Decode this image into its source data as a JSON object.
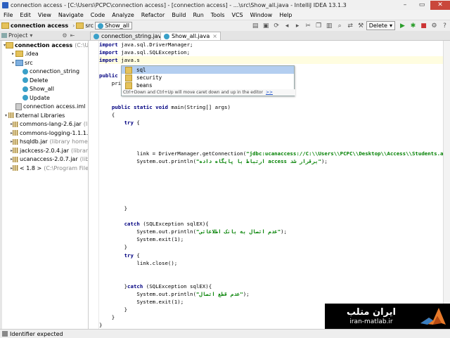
{
  "window": {
    "title": "connection access - [C:\\Users\\PCPC\\connection access] - [connection access] - ...\\src\\Show_all.java - IntelliJ IDEA 13.1.3"
  },
  "menu": [
    "File",
    "Edit",
    "View",
    "Navigate",
    "Code",
    "Analyze",
    "Refactor",
    "Build",
    "Run",
    "Tools",
    "VCS",
    "Window",
    "Help"
  ],
  "breadcrumbs": [
    "connection access",
    "src",
    "Show_all"
  ],
  "toolbar": {
    "run_config": "Delete"
  },
  "project_tab": "Project",
  "editor_tabs": [
    {
      "label": "connection_string.java",
      "active": false
    },
    {
      "label": "Show_all.java",
      "active": true
    }
  ],
  "project_tree": [
    {
      "label": "connection access",
      "note": "(C:\\Users\\PCPC",
      "indent": 0,
      "arrow": "▾",
      "icon": "folder",
      "bold": true
    },
    {
      "label": ".idea",
      "note": "",
      "indent": 1,
      "arrow": "▸",
      "icon": "folder"
    },
    {
      "label": "src",
      "note": "",
      "indent": 1,
      "arrow": "▾",
      "icon": "src"
    },
    {
      "label": "connection_string",
      "note": "",
      "indent": 2,
      "arrow": "",
      "icon": "class"
    },
    {
      "label": "Delete",
      "note": "",
      "indent": 2,
      "arrow": "",
      "icon": "class"
    },
    {
      "label": "Show_all",
      "note": "",
      "indent": 2,
      "arrow": "",
      "icon": "class"
    },
    {
      "label": "Update",
      "note": "",
      "indent": 2,
      "arrow": "",
      "icon": "class"
    },
    {
      "label": "connection access.iml",
      "note": "",
      "indent": 1,
      "arrow": "",
      "icon": "iml"
    },
    {
      "label": "External Libraries",
      "note": "",
      "indent": 0,
      "arrow": "▾",
      "icon": "lib"
    },
    {
      "label": "commons-lang-2.6.jar",
      "note": "(library",
      "indent": 1,
      "arrow": "▸",
      "icon": "lib"
    },
    {
      "label": "commons-logging-1.1.1.jar",
      "note": "(",
      "indent": 1,
      "arrow": "▸",
      "icon": "lib"
    },
    {
      "label": "hsqldb.jar",
      "note": "(library home)",
      "indent": 1,
      "arrow": "▸",
      "icon": "lib"
    },
    {
      "label": "jackcess-2.0.4.jar",
      "note": "(library home",
      "indent": 1,
      "arrow": "▸",
      "icon": "lib"
    },
    {
      "label": "ucanaccess-2.0.7.jar",
      "note": "(library h",
      "indent": 1,
      "arrow": "▸",
      "icon": "lib"
    },
    {
      "label": "< 1.8 >",
      "note": "(C:\\Program Files\\Jav",
      "indent": 1,
      "arrow": "▸",
      "icon": "lib"
    }
  ],
  "code_lines": [
    "import java.sql.DriverManager;",
    "import java.sql.SQLException;",
    "import java.s",
    "",
    "public ",
    "    pri",
    "",
    "",
    "    public static void main(String[] args)",
    "    {",
    "        try {",
    "",
    "",
    "",
    "            link = DriverManager.getConnection(\"jdbc:ucanaccess://C:\\\\Users\\\\PCPC\\\\Desktop\\\\Access\\\\Students.ac",
    "            System.out.println(\"ارتباط با پایگاه داده access برقرار شد\");",
    "",
    "",
    "",
    "",
    "",
    "        }",
    "",
    "        catch (SQLException sqlEX){",
    "            System.out.println(\"عدم اتصال به بانک اطلاعاتی\");",
    "            System.exit(1);",
    "        }",
    "        try {",
    "            link.close();",
    "",
    "",
    "        }catch (SQLException sqlEX){",
    "            System.out.println(\"عدم قطع اتصال\");",
    "            System.exit(1);",
    "        }",
    "    }",
    "}"
  ],
  "completion": {
    "items": [
      "sql",
      "security",
      "beans"
    ],
    "selected": 0,
    "hint": "Ctrl+Down and Ctrl+Up will move caret down and up in the editor",
    "hint_link": ">>"
  },
  "status": {
    "message": "Identifier expected"
  },
  "watermark": {
    "line1": "ایران متلب",
    "line2": "iran-matlab.ir"
  }
}
